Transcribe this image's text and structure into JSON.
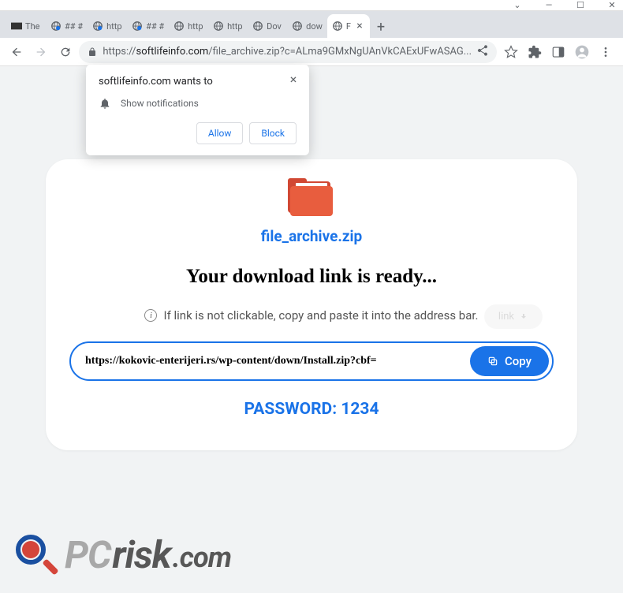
{
  "window": {
    "min": "—",
    "max": "☐",
    "close": "✕",
    "down": "⌄"
  },
  "tabs": [
    {
      "title": "The"
    },
    {
      "title": "## #"
    },
    {
      "title": "http"
    },
    {
      "title": "## #"
    },
    {
      "title": "http"
    },
    {
      "title": "http"
    },
    {
      "title": "Dov"
    },
    {
      "title": "dow"
    },
    {
      "title": "F",
      "active": true
    }
  ],
  "new_tab": "+",
  "url": {
    "scheme": "https://",
    "host": "softlifeinfo.com",
    "path": "/file_archive.zip?c=ALma9GMxNgUAnVkCAExUFwASAG..."
  },
  "notif": {
    "title": "softlifeinfo.com wants to",
    "text": "Show notifications",
    "allow": "Allow",
    "block": "Block"
  },
  "card": {
    "file_name": "file_archive.zip",
    "ready": "Your download link is ready...",
    "hint": "If link is not clickable, copy and paste it into the address bar.",
    "link_ghost": "link",
    "url": "https://kokovic-enterijeri.rs/wp-content/down/Install.zip?cbf=",
    "copy": "Copy",
    "password": "PASSWORD: 1234"
  },
  "watermark": {
    "pc": "PC",
    "risk": "risk",
    "com": ".com"
  }
}
